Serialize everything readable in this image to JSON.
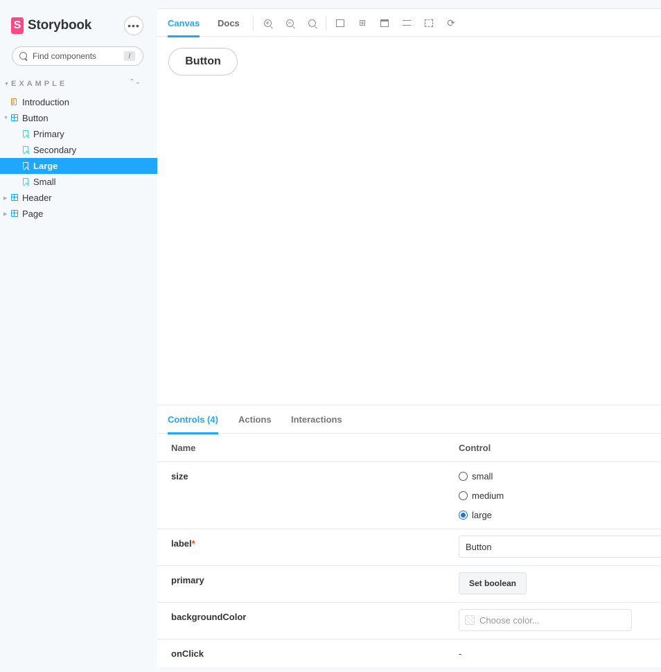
{
  "brand": {
    "name": "Storybook",
    "logo_letter": "S",
    "accent": "#ff4785"
  },
  "sidebar": {
    "menu_icon": "ellipsis-icon",
    "search_placeholder": "Find components",
    "search_shortcut": "/",
    "section_title": "EXAMPLE",
    "items": [
      {
        "label": "Introduction",
        "type": "doc"
      },
      {
        "label": "Button",
        "type": "component",
        "expanded": true
      },
      {
        "label": "Primary",
        "type": "story"
      },
      {
        "label": "Secondary",
        "type": "story"
      },
      {
        "label": "Large",
        "type": "story",
        "selected": true
      },
      {
        "label": "Small",
        "type": "story"
      },
      {
        "label": "Header",
        "type": "component",
        "expanded": false
      },
      {
        "label": "Page",
        "type": "component",
        "expanded": false
      }
    ],
    "selected_color": "#1ea7fd"
  },
  "toolbar": {
    "tabs": [
      "Canvas",
      "Docs"
    ],
    "active_tab": "Canvas",
    "tools": [
      "zoom-in-icon",
      "zoom-out-icon",
      "zoom-reset-icon",
      "background-icon",
      "grid-icon",
      "viewport-icon",
      "measure-icon",
      "outline-icon",
      "remount-icon"
    ]
  },
  "canvas": {
    "preview_button_label": "Button"
  },
  "addons": {
    "tabs": [
      "Controls (4)",
      "Actions",
      "Interactions"
    ],
    "active_tab": "Controls (4)",
    "table_headers": {
      "name": "Name",
      "control": "Control"
    },
    "rows": {
      "size": {
        "name": "size",
        "options": [
          "small",
          "medium",
          "large"
        ],
        "selected": "large"
      },
      "label": {
        "name": "label",
        "required_mark": "*",
        "value": "Button"
      },
      "primary": {
        "name": "primary",
        "button_label": "Set boolean"
      },
      "backgroundColor": {
        "name": "backgroundColor",
        "placeholder": "Choose color..."
      },
      "onClick": {
        "name": "onClick",
        "value": "-"
      }
    }
  }
}
